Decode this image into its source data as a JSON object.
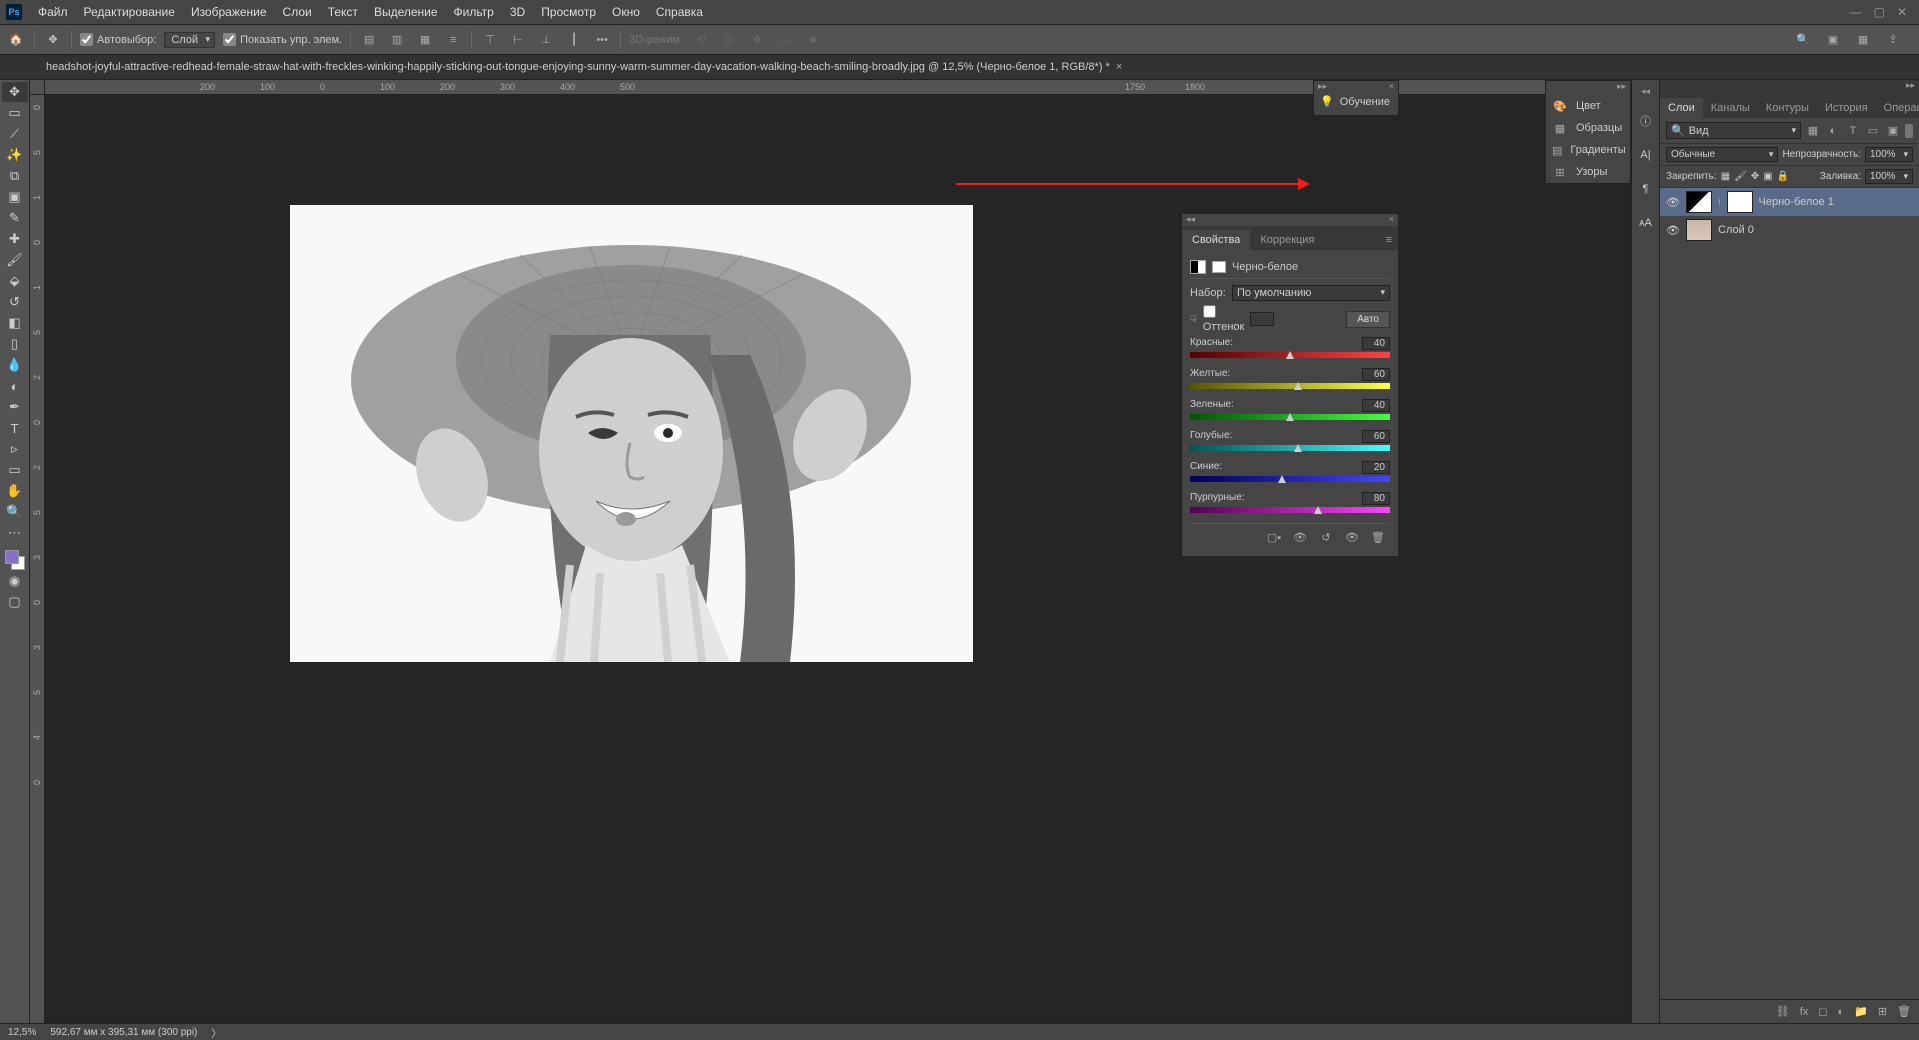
{
  "menus": [
    "Файл",
    "Редактирование",
    "Изображение",
    "Слои",
    "Текст",
    "Выделение",
    "Фильтр",
    "3D",
    "Просмотр",
    "Окно",
    "Справка"
  ],
  "optbar": {
    "auto_select": "Автовыбор:",
    "layer_select": "Слой",
    "show_transform": "Показать упр. элем.",
    "mode3d": "3D-режим:"
  },
  "tab_title": "headshot-joyful-attractive-redhead-female-straw-hat-with-freckles-winking-happily-sticking-out-tongue-enjoying-sunny-warm-summer-day-vacation-walking-beach-smiling-broadly.jpg @ 12,5% (Черно-белое 1, RGB/8*) *",
  "ruler_h": [
    "200",
    "100",
    "0",
    "100",
    "200",
    "300",
    "400",
    "500",
    "1750",
    "1800"
  ],
  "ruler_v": [
    "0",
    "5",
    "1",
    "0",
    "1",
    "5",
    "2",
    "0",
    "2",
    "5",
    "3",
    "0",
    "3",
    "5",
    "4",
    "0"
  ],
  "flyout": {
    "items": [
      "Цвет",
      "Образцы",
      "Градиенты",
      "Узоры"
    ]
  },
  "learn": "Обучение",
  "props": {
    "tab_props": "Свойства",
    "tab_corr": "Коррекция",
    "title": "Черно-белое",
    "preset_lbl": "Набор:",
    "preset_val": "По умолчанию",
    "tint": "Оттенок",
    "auto": "Авто",
    "sliders": [
      {
        "label": "Красные:",
        "val": "40",
        "pos": 48,
        "grad": "linear-gradient(90deg,#500,#f44)"
      },
      {
        "label": "Желтые:",
        "val": "60",
        "pos": 52,
        "grad": "linear-gradient(90deg,#550,#ff4)"
      },
      {
        "label": "Зеленые:",
        "val": "40",
        "pos": 48,
        "grad": "linear-gradient(90deg,#050,#4f4)"
      },
      {
        "label": "Голубые:",
        "val": "60",
        "pos": 52,
        "grad": "linear-gradient(90deg,#055,#4ff)"
      },
      {
        "label": "Синие:",
        "val": "20",
        "pos": 44,
        "grad": "linear-gradient(90deg,#005,#44f)"
      },
      {
        "label": "Пурпурные:",
        "val": "80",
        "pos": 62,
        "grad": "linear-gradient(90deg,#505,#f4f)"
      }
    ]
  },
  "rpanel": {
    "tabs": [
      "Слои",
      "Каналы",
      "Контуры",
      "История",
      "Операции"
    ],
    "search": "Вид",
    "blend": "Обычные",
    "opacity_lbl": "Непрозрачность:",
    "opacity_val": "100%",
    "lock_lbl": "Закрепить:",
    "fill_lbl": "Заливка:",
    "fill_val": "100%",
    "layers": [
      {
        "name": "Черно-белое 1",
        "adj": true
      },
      {
        "name": "Слой 0",
        "adj": false
      }
    ]
  },
  "status": {
    "zoom": "12,5%",
    "dim": "592,67 мм x 395,31 мм (300 ppi)"
  }
}
